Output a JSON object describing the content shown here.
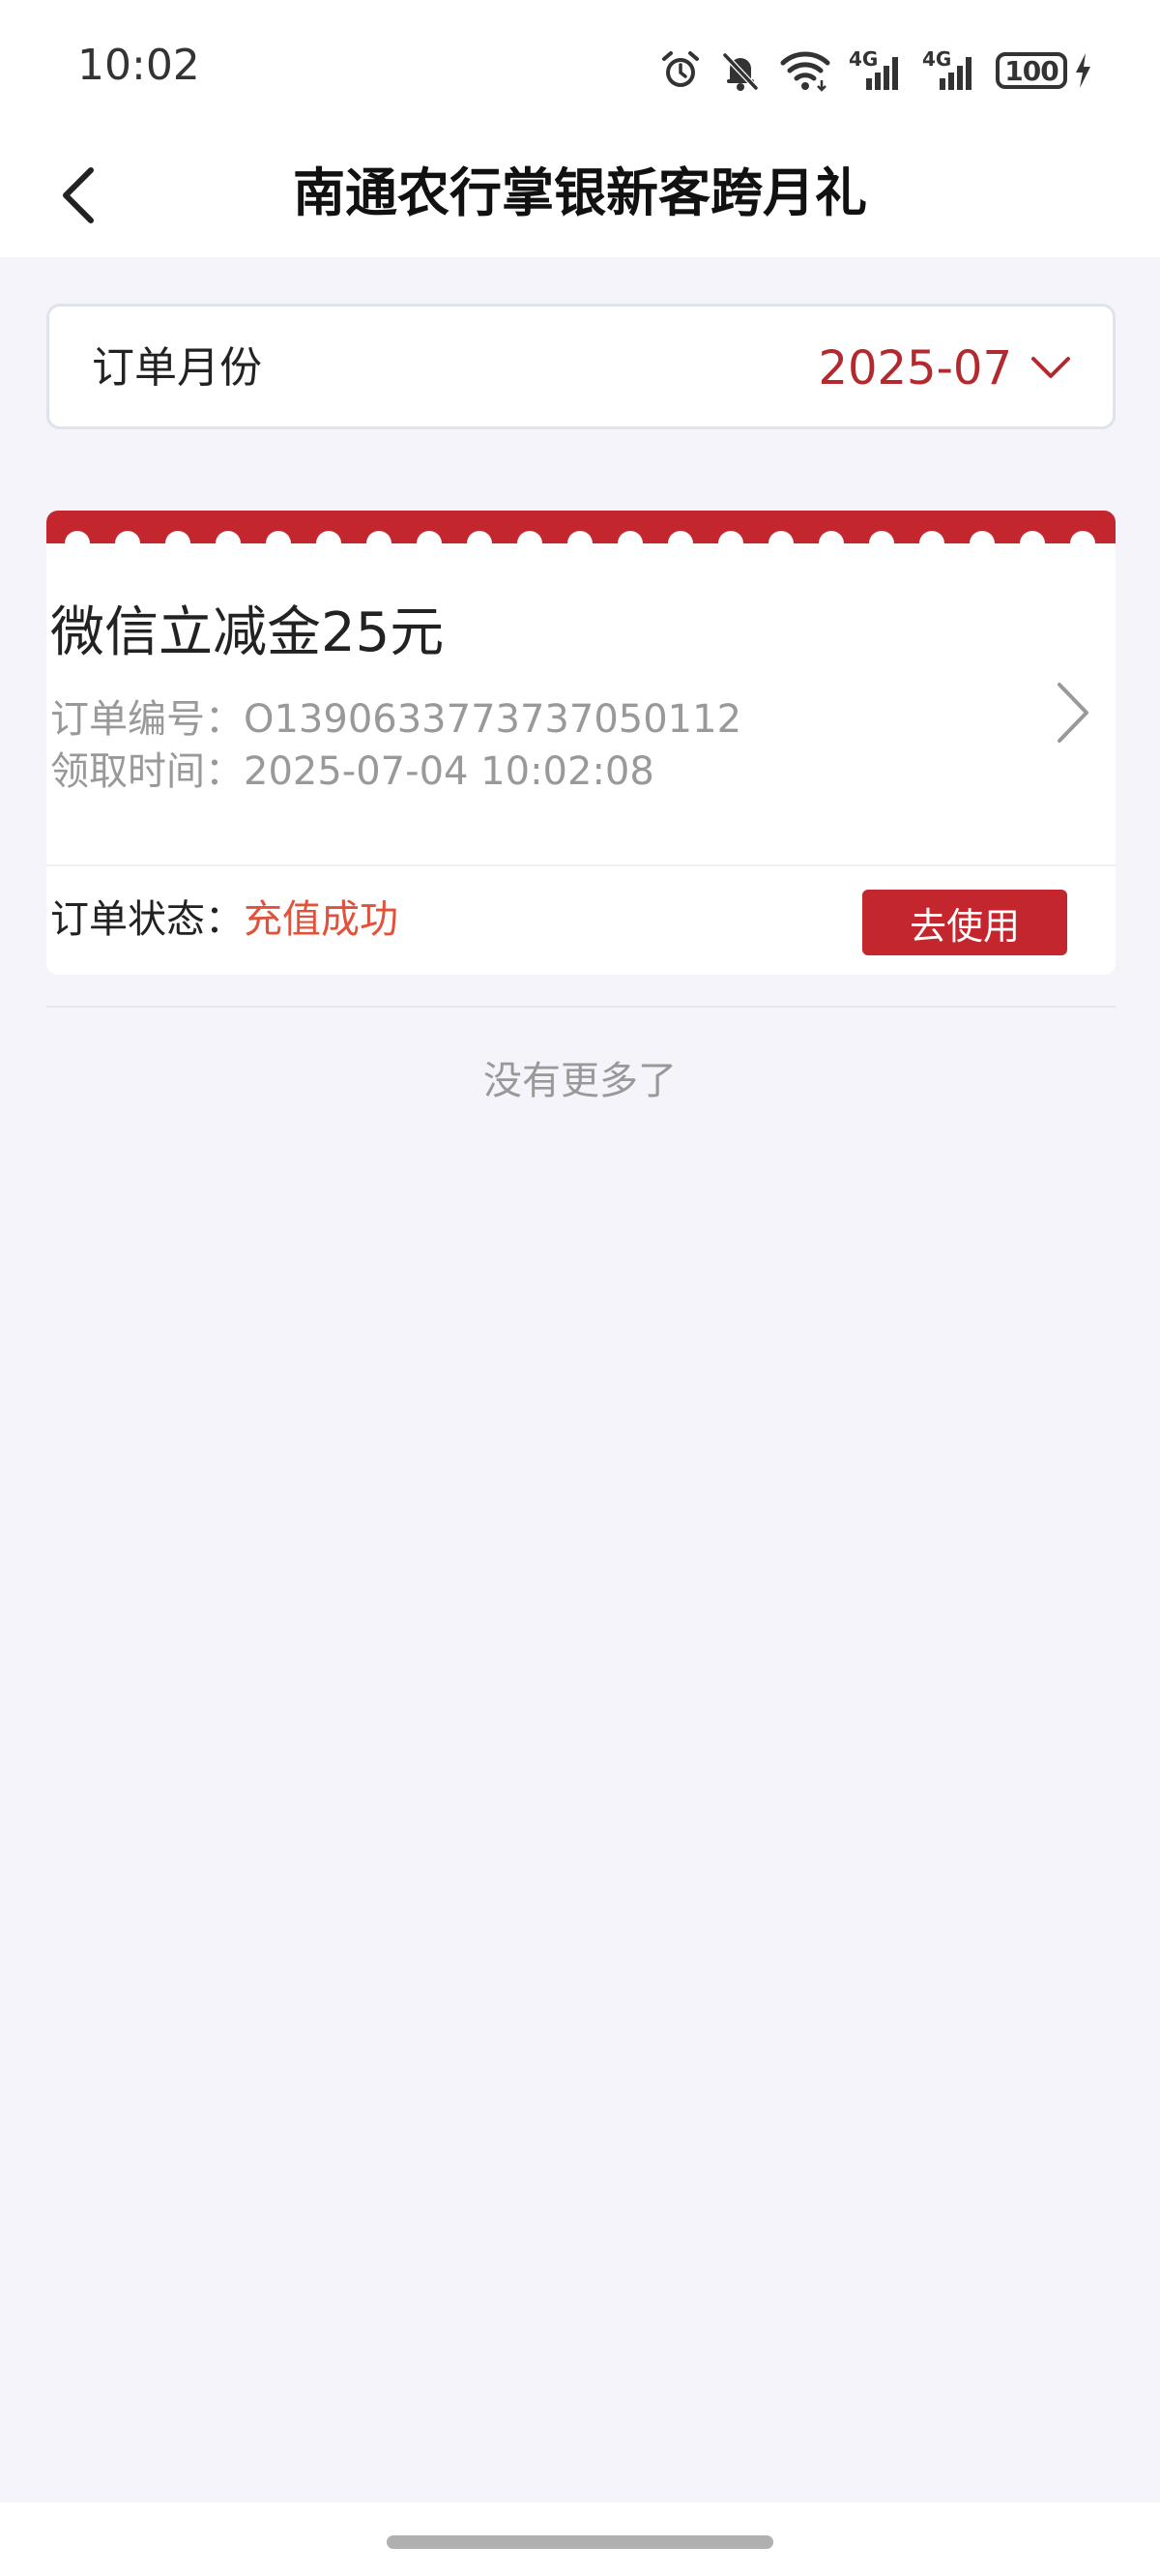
{
  "status_bar": {
    "time": "10:02",
    "icons": [
      "alarm-icon",
      "mute-bell-icon",
      "wifi-icon",
      "signal-4g-icon",
      "signal-4g-icon",
      "battery-icon",
      "charging-icon"
    ],
    "network_1": "4G",
    "network_2": "4G",
    "battery": "100"
  },
  "header": {
    "title": "南通农行掌银新客跨月礼",
    "back_icon": "chevron-left-icon"
  },
  "month_selector": {
    "label": "订单月份",
    "value": "2025-07",
    "value_color": "#b22a2e",
    "icon": "chevron-down-icon"
  },
  "orders": [
    {
      "title": "微信立减金25元",
      "order_no_label": "订单编号：",
      "order_no": "O1390633773737050112",
      "time_label": "领取时间：",
      "time": "2025-07-04 10:02:08",
      "status_label": "订单状态：",
      "status": "充值成功",
      "status_color": "#e0523a",
      "action_label": "去使用",
      "accent_color": "#c4262e"
    }
  ],
  "list_footer": "没有更多了"
}
